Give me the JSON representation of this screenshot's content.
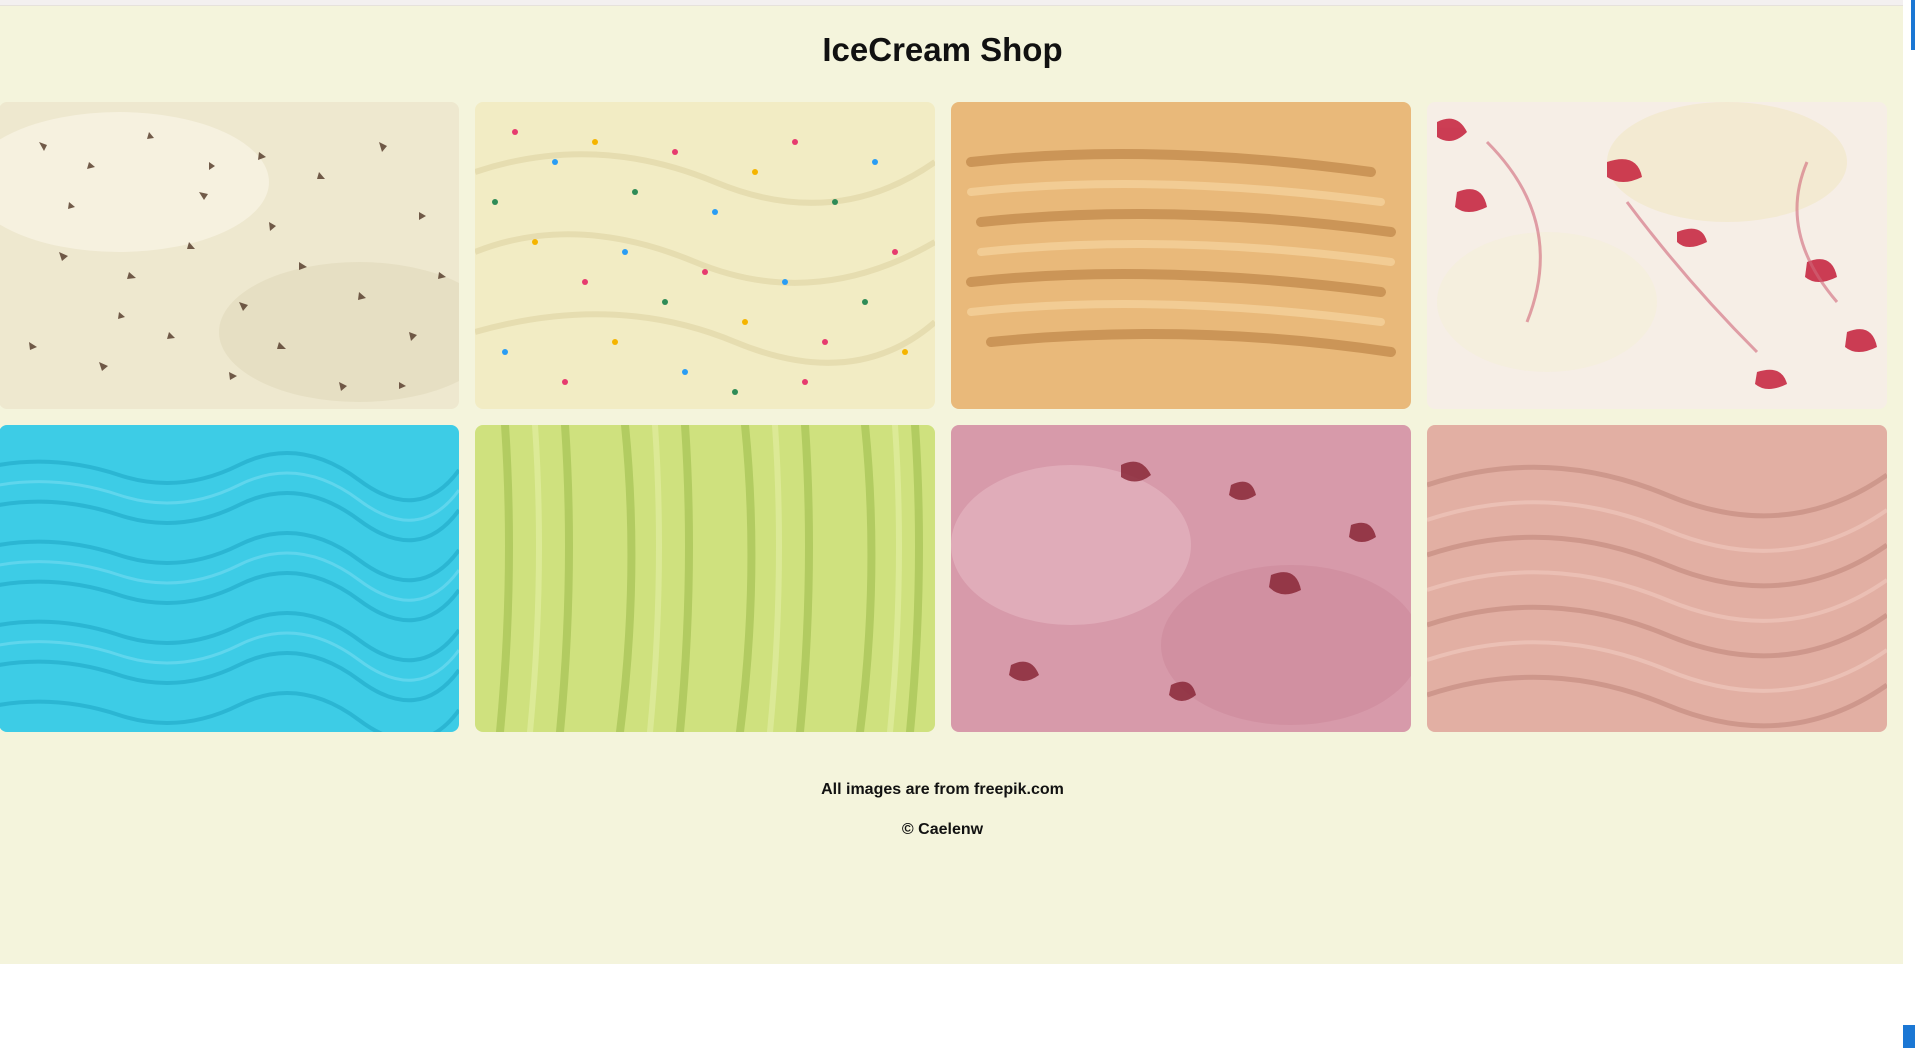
{
  "page": {
    "title": "IceCream Shop",
    "background": "#f4f4dc"
  },
  "gallery": [
    {
      "name": "chocolate-chip-vanilla",
      "base": "#eee8cf",
      "accent": "#5a4130"
    },
    {
      "name": "vanilla-sprinkles",
      "base": "#f2ecc4",
      "accent": "#d9cf9a"
    },
    {
      "name": "caramel",
      "base": "#e9b97a",
      "accent": "#b98548"
    },
    {
      "name": "raspberry-ripple",
      "base": "#f6eee6",
      "accent": "#c41e3a"
    },
    {
      "name": "blue",
      "base": "#3dcce6",
      "accent": "#2bb1cf"
    },
    {
      "name": "green-tea",
      "base": "#cfe17e",
      "accent": "#a9c458"
    },
    {
      "name": "cherry",
      "base": "#d79aaa",
      "accent": "#8a2838"
    },
    {
      "name": "chocolate-milk",
      "base": "#e2afa3",
      "accent": "#c68e82"
    }
  ],
  "footer": {
    "credit": "All images are from freepik.com",
    "copyright": "© Caelenw"
  }
}
